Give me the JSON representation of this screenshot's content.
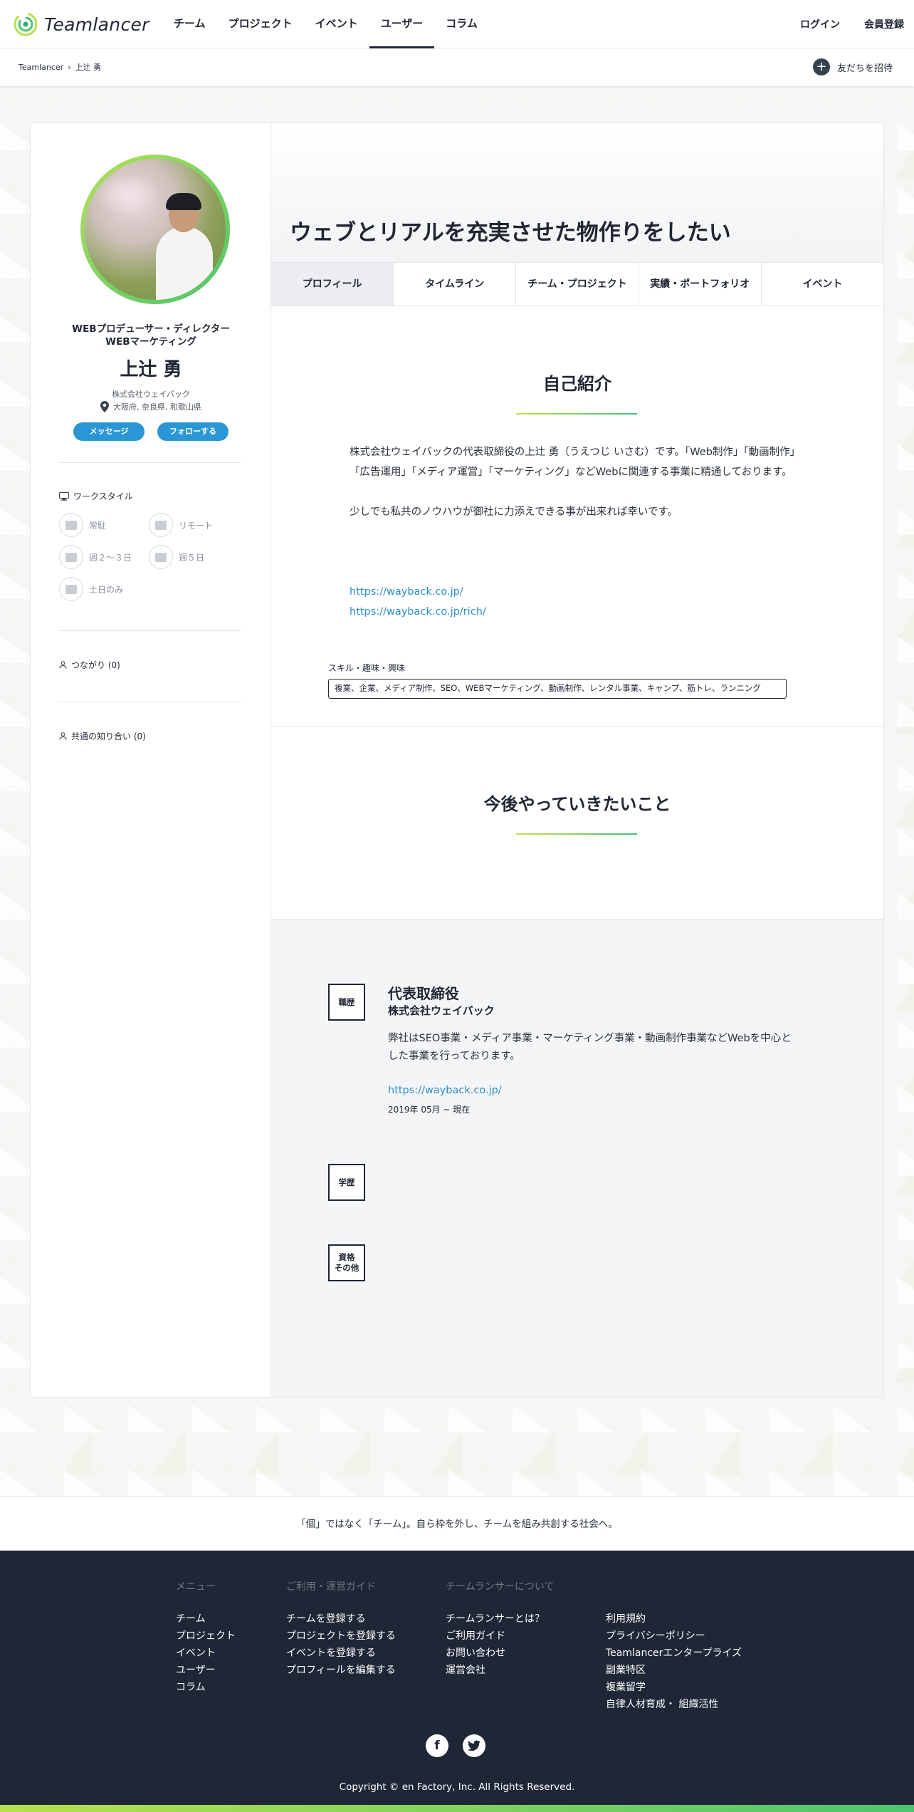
{
  "header": {
    "logo": "Teamlancer",
    "nav": [
      "チーム",
      "プロジェクト",
      "イベント",
      "ユーザー",
      "コラム"
    ],
    "active_nav": "ユーザー",
    "login": "ログイン",
    "register": "会員登録"
  },
  "subbar": {
    "breadcrumb_root": "Teamlancer",
    "breadcrumb_sep": "›",
    "breadcrumb_current": "上辻 勇",
    "invite": "友だちを招待"
  },
  "profile": {
    "role_line1": "WEBプロデューサー・ディレクター",
    "role_line2": "WEBマーケティング",
    "name": "上辻 勇",
    "company": "株式会社ウェイバック",
    "location": "大阪府, 奈良県, 和歌山県",
    "message_btn": "メッセージ",
    "follow_btn": "フォローする",
    "workstyle_title": "ワークスタイル",
    "workstyles": [
      "常駐",
      "リモート",
      "週２〜３日",
      "週５日",
      "土日のみ"
    ],
    "connections": "つながり (0)",
    "mutual": "共通の知り合い (0)"
  },
  "main": {
    "headline": "ウェブとリアルを充実させた物作りをしたい",
    "tabs": [
      "プロフィール",
      "タイムライン",
      "チーム・プロジェクト",
      "実績・ポートフォリオ",
      "イベント"
    ],
    "active_tab": "プロフィール",
    "intro_title": "自己紹介",
    "intro_p1": "株式会社ウェイバックの代表取締役の上辻 勇（うえつじ いさむ）です。「Web制作」「動画制作」「広告運用」「メディア運営」「マーケティング」などWebに関連する事業に精通しております。",
    "intro_p2": "少しでも私共のノウハウが御社に力添えできる事が出来れば幸いです。",
    "links": [
      "https://wayback.co.jp/",
      "https://wayback.co.jp/rich/"
    ],
    "skills_label": "スキル・趣味・興味",
    "skills": "複業、企業、メディア制作、SEO、WEBマーケティング、動画制作、レンタル事業、キャンプ、筋トレ、ランニング",
    "future_title": "今後やっていきたいこと"
  },
  "career": {
    "badge_work": "職歴",
    "badge_edu": "学歴",
    "badge_other_1": "資格",
    "badge_other_2": "その他",
    "title": "代表取締役",
    "company": "株式会社ウェイバック",
    "description": "弊社はSEO事業・メディア事業・マーケティング事業・動画制作事業などWebを中心とした事業を行っております。",
    "link": "https://wayback.co.jp/",
    "period": "2019年 05月 ~ 現在"
  },
  "tagline": "「個」ではなく「チーム」。自ら枠を外し、チームを組み共創する社会へ。",
  "footer": {
    "menu_head": "メニュー",
    "menu": [
      "チーム",
      "プロジェクト",
      "イベント",
      "ユーザー",
      "コラム"
    ],
    "guide_head": "ご利用・運営ガイド",
    "guide": [
      "チームを登録する",
      "プロジェクトを登録する",
      "イベントを登録する",
      "プロフィールを編集する"
    ],
    "about_head": "チームランサーについて",
    "about": [
      "チームランサーとは？",
      "ご利用ガイド",
      "お問い合わせ",
      "運営会社"
    ],
    "legal": [
      "利用規約",
      "プライバシーポリシー",
      "Teamlancerエンタープライズ",
      "副業特区",
      "複業留学",
      "自律人材育成・ 組織活性"
    ],
    "copyright": "Copyright © en Factory, Inc. All Rights Reserved.",
    "social_icons": [
      "facebook-icon",
      "twitter-icon"
    ]
  },
  "colors": {
    "accent_blue": "#2a96d6",
    "gradient_start": "#c6e04f",
    "gradient_end": "#3fbf7a",
    "footer_bg": "#1f2736"
  }
}
